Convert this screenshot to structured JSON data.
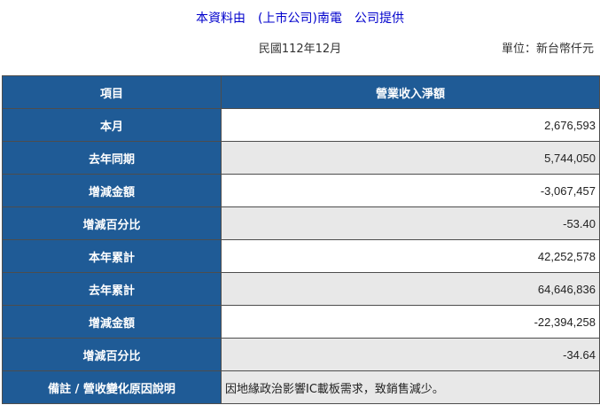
{
  "header": {
    "source": "本資料由　(上市公司)南電　公司提供",
    "period": "民國112年12月",
    "unit": "單位：新台幣仟元"
  },
  "table": {
    "col_item": "項目",
    "col_value": "營業收入淨額",
    "rows": [
      {
        "label": "本月",
        "value": "2,676,593"
      },
      {
        "label": "去年同期",
        "value": "5,744,050"
      },
      {
        "label": "增減金額",
        "value": "-3,067,457"
      },
      {
        "label": "增減百分比",
        "value": "-53.40"
      },
      {
        "label": "本年累計",
        "value": "42,252,578"
      },
      {
        "label": "去年累計",
        "value": "64,646,836"
      },
      {
        "label": "增減金額",
        "value": "-22,394,258"
      },
      {
        "label": "增減百分比",
        "value": "-34.64"
      }
    ],
    "note_label": "備註 / 營收變化原因說明",
    "note_value": "因地緣政治影響IC載板需求，致銷售減少。"
  }
}
